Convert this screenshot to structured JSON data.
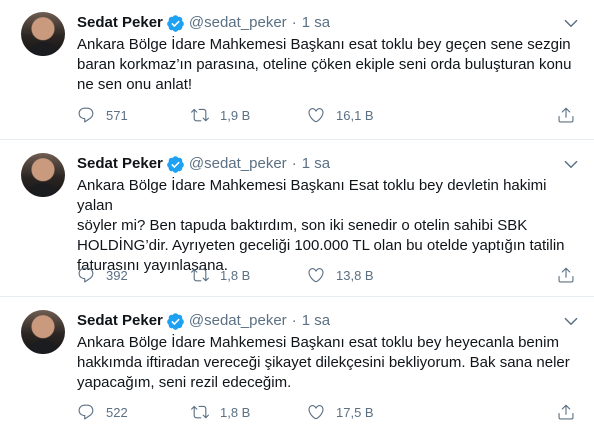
{
  "tweets": [
    {
      "display_name": "Sedat Peker",
      "handle": "@sedat_peker",
      "separator": "·",
      "time": "1 sa",
      "text": "Ankara Bölge İdare Mahkemesi Başkanı esat toklu bey geçen sene sezgin\nbaran korkmaz’ın parasına, oteline çöken ekiple seni orda buluşturan konu\nne sen onu anlat!",
      "replies": "571",
      "retweets": "1,9 B",
      "likes": "16,1 B"
    },
    {
      "display_name": "Sedat Peker",
      "handle": "@sedat_peker",
      "separator": "·",
      "time": "1 sa",
      "text": "Ankara Bölge İdare Mahkemesi Başkanı Esat toklu bey devletin hakimi yalan\nsöyler mi? Ben tapuda baktırdım, son iki senedir o otelin sahibi SBK\nHOLDİNG’dir. Ayrıyeten geceliği 100.000 TL olan bu otelde yaptığın tatilin\nfaturasını yayınlasana.",
      "replies": "392",
      "retweets": "1,8 B",
      "likes": "13,8 B"
    },
    {
      "display_name": "Sedat Peker",
      "handle": "@sedat_peker",
      "separator": "·",
      "time": "1 sa",
      "text": "Ankara Bölge İdare Mahkemesi Başkanı esat toklu bey heyecanla benim\nhakkımda iftiradan vereceği şikayet dilekçesini bekliyorum. Bak sana neler\nyapacağım, seni rezil edeceğim.",
      "replies": "522",
      "retweets": "1,8 B",
      "likes": "17,5 B"
    }
  ],
  "icons": {
    "verified": "verified-badge-icon",
    "more": "chevron-down-icon",
    "reply": "reply-icon",
    "retweet": "retweet-icon",
    "like": "heart-icon",
    "share": "share-icon"
  },
  "colors": {
    "verified": "#1da1f2",
    "text": "#0f1419",
    "muted": "#5b7083",
    "divider": "#e6ecf0"
  }
}
